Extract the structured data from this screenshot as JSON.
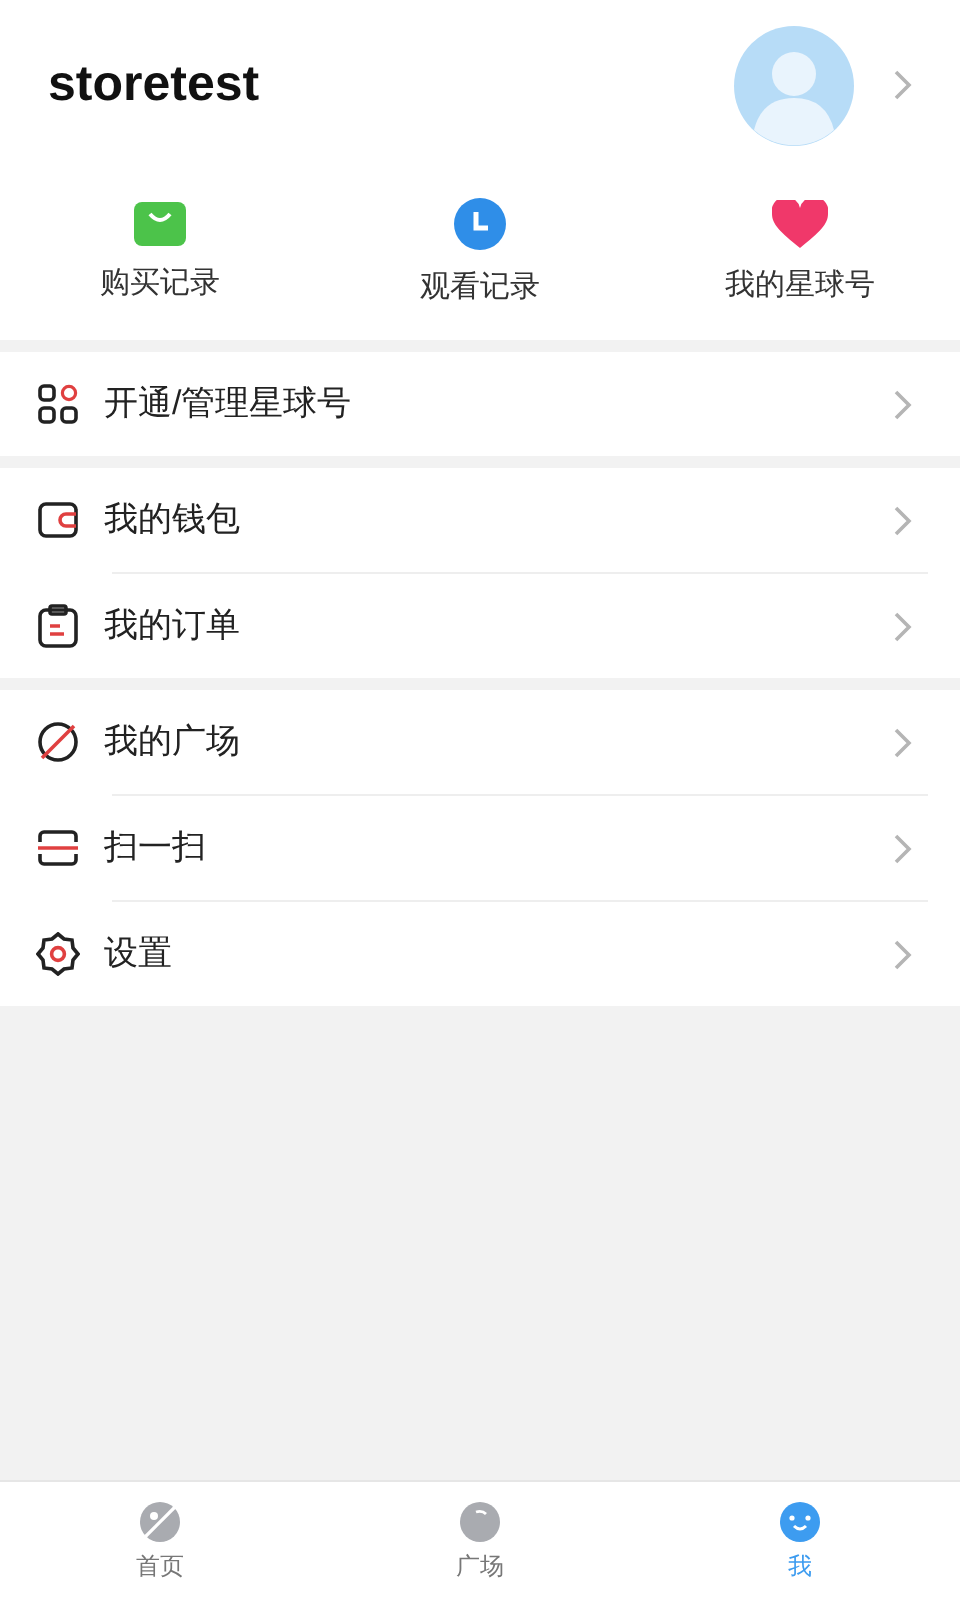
{
  "profile": {
    "username": "storetest"
  },
  "shortcuts": [
    {
      "kind": "bag",
      "label": "购买记录"
    },
    {
      "kind": "clock",
      "label": "观看记录"
    },
    {
      "kind": "heart",
      "label": "我的星球号"
    }
  ],
  "menu_groups": [
    [
      {
        "kind": "grid",
        "label": "开通/管理星球号"
      }
    ],
    [
      {
        "kind": "wallet",
        "label": "我的钱包"
      },
      {
        "kind": "clipboard",
        "label": "我的订单"
      }
    ],
    [
      {
        "kind": "planet",
        "label": "我的广场"
      },
      {
        "kind": "scan",
        "label": "扫一扫"
      },
      {
        "kind": "gear",
        "label": "设置"
      }
    ]
  ],
  "tab_bar": [
    {
      "kind": "planet",
      "label": "首页",
      "selected": false
    },
    {
      "kind": "ball",
      "label": "广场",
      "selected": false
    },
    {
      "kind": "face",
      "label": "我",
      "selected": true
    }
  ]
}
